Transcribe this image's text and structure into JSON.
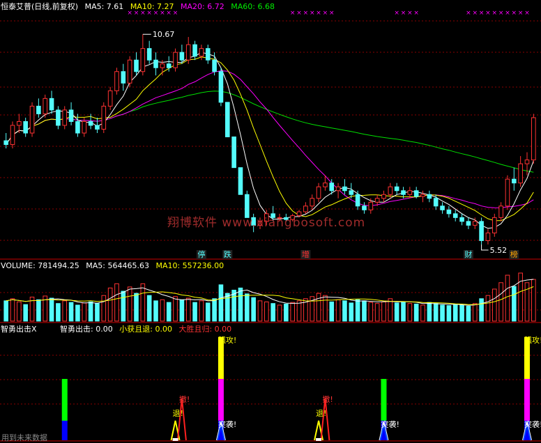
{
  "header": {
    "title": "恒泰艾普(日线,前复权)",
    "ma5": "MA5: 7.61",
    "ma10": "MA10: 7.27",
    "ma20": "MA20: 6.72",
    "ma60": "MA60: 6.68"
  },
  "volume_header": {
    "volume": "VOLUME: 781494.25",
    "ma5": "MA5: 564465.63",
    "ma10": "MA10: 557236.00"
  },
  "indicator_header": {
    "name": "智勇出击X",
    "v1": "智勇出击: 0.00",
    "v2": "小获且退: 0.00",
    "v3": "大胜且归: 0.00"
  },
  "watermark": "翔博软件 www.xiangbosoft.com",
  "footnote": "用到未来数据",
  "colors": {
    "background": "#000000",
    "up": "#ff3232",
    "down": "#54fcfc",
    "ma5": "#ffffff",
    "ma10": "#ffff00",
    "ma20": "#ff00ff",
    "ma60": "#00e000",
    "grid": "#8b0000"
  },
  "chart_data": {
    "type": "candlestick",
    "ohlc": [
      [
        7.9,
        8.1,
        7.7,
        7.8
      ],
      [
        7.8,
        8.4,
        7.7,
        8.3
      ],
      [
        8.3,
        8.6,
        8.1,
        8.4
      ],
      [
        8.4,
        8.5,
        8.0,
        8.1
      ],
      [
        8.1,
        8.9,
        8.0,
        8.8
      ],
      [
        8.8,
        9.0,
        8.5,
        8.6
      ],
      [
        8.6,
        9.1,
        8.5,
        9.0
      ],
      [
        9.0,
        9.2,
        8.6,
        8.7
      ],
      [
        8.7,
        8.8,
        8.2,
        8.3
      ],
      [
        8.3,
        8.8,
        8.2,
        8.7
      ],
      [
        8.7,
        8.9,
        8.3,
        8.4
      ],
      [
        8.4,
        8.6,
        8.0,
        8.1
      ],
      [
        8.1,
        8.5,
        8.0,
        8.4
      ],
      [
        8.4,
        8.6,
        8.2,
        8.3
      ],
      [
        8.3,
        8.5,
        8.1,
        8.2
      ],
      [
        8.2,
        8.9,
        8.1,
        8.8
      ],
      [
        8.8,
        9.3,
        8.7,
        9.2
      ],
      [
        9.2,
        9.8,
        9.1,
        9.7
      ],
      [
        9.7,
        9.9,
        9.2,
        9.4
      ],
      [
        9.4,
        10.1,
        9.3,
        10.0
      ],
      [
        10.0,
        10.2,
        9.6,
        9.7
      ],
      [
        9.7,
        10.67,
        9.6,
        10.3
      ],
      [
        10.3,
        10.5,
        9.9,
        10.0
      ],
      [
        10.0,
        10.2,
        9.6,
        9.8
      ],
      [
        9.8,
        10.0,
        9.6,
        9.9
      ],
      [
        9.9,
        10.1,
        9.7,
        9.8
      ],
      [
        9.8,
        10.3,
        9.7,
        10.2
      ],
      [
        10.2,
        10.4,
        9.9,
        10.0
      ],
      [
        10.0,
        10.6,
        9.9,
        10.4
      ],
      [
        10.4,
        10.5,
        10.0,
        10.1
      ],
      [
        10.1,
        10.4,
        10.0,
        10.3
      ],
      [
        10.3,
        10.4,
        9.9,
        10.0
      ],
      [
        10.0,
        10.2,
        9.6,
        9.7
      ],
      [
        9.7,
        9.8,
        8.8,
        8.9
      ],
      [
        8.9,
        8.9,
        8.0,
        8.0
      ],
      [
        8.0,
        8.0,
        7.2,
        7.2
      ],
      [
        7.2,
        7.2,
        6.5,
        6.5
      ],
      [
        6.5,
        6.6,
        5.9,
        5.9
      ],
      [
        5.9,
        6.0,
        5.52,
        5.7
      ],
      [
        5.7,
        5.9,
        5.6,
        5.8
      ],
      [
        5.8,
        6.1,
        5.7,
        6.0
      ],
      [
        6.0,
        6.2,
        5.8,
        5.9
      ],
      [
        5.9,
        6.0,
        5.8,
        5.9
      ],
      [
        5.9,
        6.0,
        5.8,
        5.85
      ],
      [
        5.85,
        6.0,
        5.8,
        5.95
      ],
      [
        5.95,
        6.1,
        5.9,
        6.05
      ],
      [
        6.05,
        6.3,
        6.0,
        6.2
      ],
      [
        6.2,
        6.5,
        6.1,
        6.4
      ],
      [
        6.4,
        6.8,
        6.3,
        6.7
      ],
      [
        6.7,
        7.0,
        6.6,
        6.8
      ],
      [
        6.8,
        6.9,
        6.5,
        6.6
      ],
      [
        6.6,
        6.8,
        6.4,
        6.7
      ],
      [
        6.7,
        6.9,
        6.5,
        6.6
      ],
      [
        6.6,
        6.8,
        6.4,
        6.5
      ],
      [
        6.5,
        6.6,
        6.1,
        6.2
      ],
      [
        6.2,
        6.3,
        6.0,
        6.1
      ],
      [
        6.1,
        6.4,
        6.0,
        6.3
      ],
      [
        6.3,
        6.5,
        6.2,
        6.4
      ],
      [
        6.4,
        6.6,
        6.3,
        6.5
      ],
      [
        6.5,
        6.8,
        6.4,
        6.7
      ],
      [
        6.7,
        6.8,
        6.5,
        6.6
      ],
      [
        6.6,
        6.7,
        6.4,
        6.5
      ],
      [
        6.5,
        6.7,
        6.4,
        6.6
      ],
      [
        6.6,
        6.7,
        6.4,
        6.45
      ],
      [
        6.45,
        6.6,
        6.3,
        6.5
      ],
      [
        6.5,
        6.6,
        6.3,
        6.4
      ],
      [
        6.4,
        6.5,
        6.1,
        6.2
      ],
      [
        6.2,
        6.3,
        6.0,
        6.1
      ],
      [
        6.1,
        6.2,
        5.9,
        6.0
      ],
      [
        6.0,
        6.1,
        5.8,
        5.9
      ],
      [
        5.9,
        6.0,
        5.7,
        5.8
      ],
      [
        5.8,
        5.9,
        5.6,
        5.7
      ],
      [
        5.7,
        5.9,
        5.6,
        5.8
      ],
      [
        5.8,
        5.9,
        5.2,
        5.3
      ],
      [
        5.3,
        5.6,
        5.2,
        5.5
      ],
      [
        5.5,
        6.0,
        5.4,
        5.9
      ],
      [
        5.9,
        6.3,
        5.8,
        6.2
      ],
      [
        6.2,
        7.0,
        6.1,
        6.9
      ],
      [
        6.9,
        7.2,
        6.6,
        6.8
      ],
      [
        6.8,
        7.5,
        6.7,
        7.3
      ],
      [
        7.3,
        7.6,
        7.0,
        7.4
      ],
      [
        7.4,
        8.6,
        7.3,
        8.5
      ]
    ],
    "volume": [
      380,
      420,
      360,
      310,
      450,
      400,
      470,
      430,
      330,
      380,
      350,
      300,
      340,
      360,
      330,
      480,
      620,
      700,
      560,
      640,
      520,
      700,
      480,
      380,
      400,
      350,
      460,
      400,
      430,
      350,
      380,
      340,
      420,
      680,
      520,
      580,
      620,
      510,
      440,
      380,
      360,
      330,
      300,
      320,
      350,
      380,
      420,
      460,
      520,
      480,
      360,
      400,
      380,
      340,
      400,
      380,
      350,
      330,
      360,
      420,
      340,
      360,
      330,
      320,
      300,
      350,
      330,
      300,
      290,
      310,
      300,
      280,
      330,
      420,
      480,
      600,
      720,
      860,
      650,
      900,
      720,
      781
    ],
    "ylabel": "",
    "annotations": [
      "10.67",
      "5.52"
    ],
    "markers": [
      "停",
      "跌",
      "增",
      "财",
      "榜"
    ],
    "signals": [
      "强攻!",
      "突袭!",
      "退!",
      "撤!"
    ]
  }
}
